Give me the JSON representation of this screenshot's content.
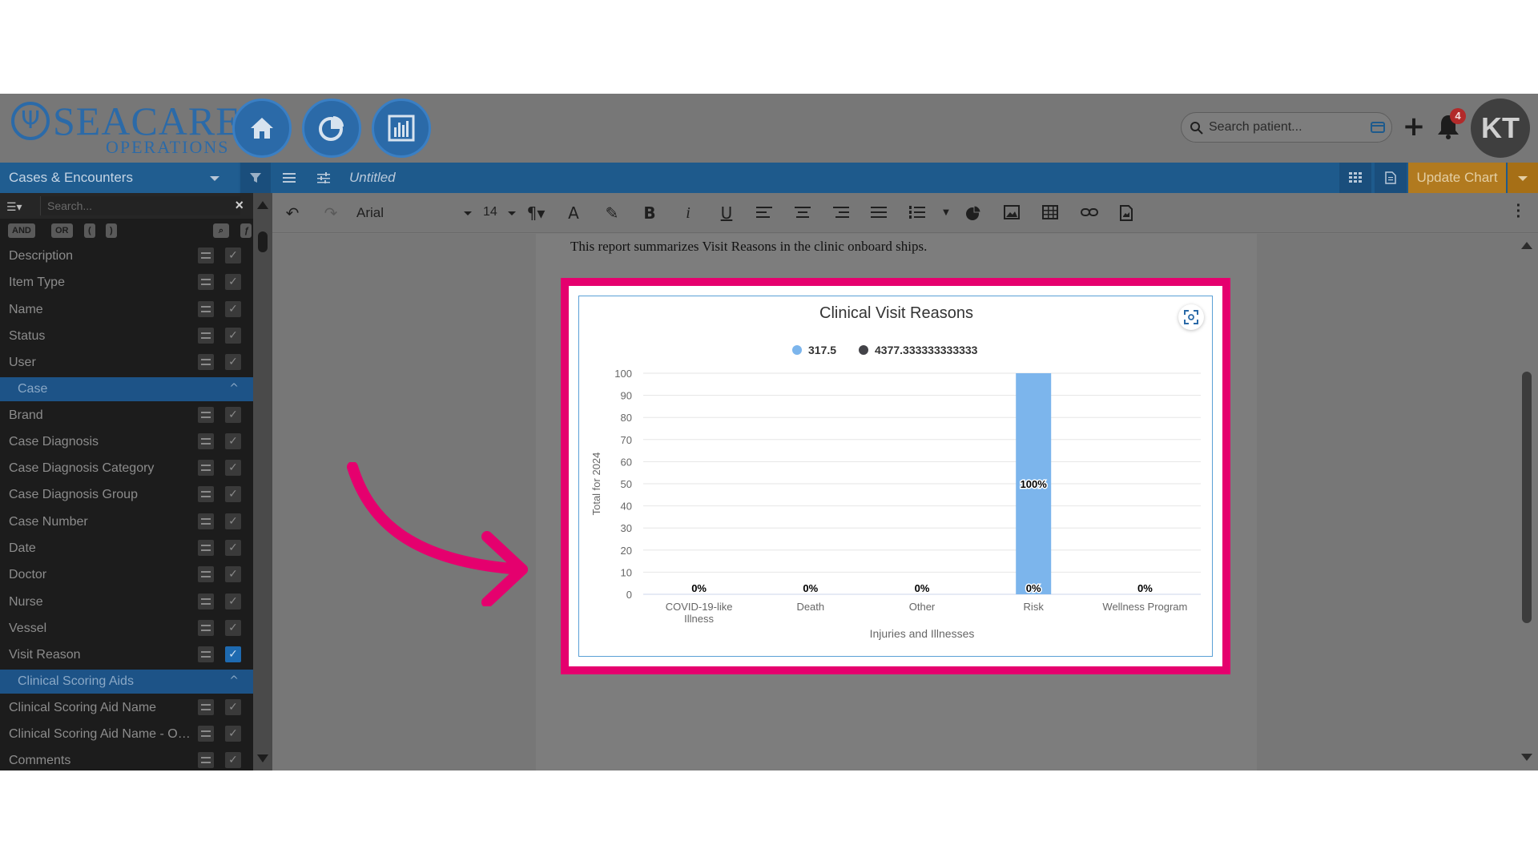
{
  "app": {
    "logo_title": "SEACARE",
    "logo_subtitle": "OPERATIONS",
    "search_placeholder": "Search patient...",
    "notification_count": "4",
    "avatar_initials": "KT"
  },
  "toolbar": {
    "dataset": "Cases & Encounters",
    "doc_title": "Untitled",
    "update_label": "Update Chart"
  },
  "sidebar": {
    "search_placeholder": "Search...",
    "ops": [
      "AND",
      "OR",
      "(",
      ")"
    ],
    "rows": [
      {
        "type": "field",
        "label": "Description",
        "checked": false
      },
      {
        "type": "field",
        "label": "Item Type",
        "checked": false
      },
      {
        "type": "field",
        "label": "Name",
        "checked": false
      },
      {
        "type": "field",
        "label": "Status",
        "checked": false
      },
      {
        "type": "field",
        "label": "User",
        "checked": false
      },
      {
        "type": "group",
        "label": "Case"
      },
      {
        "type": "field",
        "label": "Brand",
        "checked": false
      },
      {
        "type": "field",
        "label": "Case Diagnosis",
        "checked": false
      },
      {
        "type": "field",
        "label": "Case Diagnosis Category",
        "checked": false
      },
      {
        "type": "field",
        "label": "Case Diagnosis Group",
        "checked": false
      },
      {
        "type": "field",
        "label": "Case Number",
        "checked": false
      },
      {
        "type": "field",
        "label": "Date",
        "checked": false
      },
      {
        "type": "field",
        "label": "Doctor",
        "checked": false
      },
      {
        "type": "field",
        "label": "Nurse",
        "checked": false
      },
      {
        "type": "field",
        "label": "Vessel",
        "checked": false
      },
      {
        "type": "field",
        "label": "Visit Reason",
        "checked": true
      },
      {
        "type": "group",
        "label": "Clinical Scoring Aids"
      },
      {
        "type": "field",
        "label": "Clinical Scoring Aid Name",
        "checked": false
      },
      {
        "type": "field",
        "label": "Clinical Scoring Aid Name - Ot...",
        "checked": false
      },
      {
        "type": "field",
        "label": "Comments",
        "checked": false
      }
    ]
  },
  "editor": {
    "font": "Arial",
    "font_size": "14",
    "intro_text": "This report summarizes Visit Reasons in the clinic onboard ships."
  },
  "chart_data": {
    "type": "bar",
    "title": "Clinical Visit Reasons",
    "xlabel": "Injuries and Illnesses",
    "ylabel": "Total for 2024",
    "ylim": [
      0,
      100
    ],
    "yticks": [
      0,
      10,
      20,
      30,
      40,
      50,
      60,
      70,
      80,
      90,
      100
    ],
    "categories": [
      "COVID-19-like Illness",
      "Death",
      "Other",
      "Risk",
      "Wellness Program"
    ],
    "category_lines": [
      [
        "COVID-19-like",
        "Illness"
      ],
      [
        "Death"
      ],
      [
        "Other"
      ],
      [
        "Risk"
      ],
      [
        "Wellness Program"
      ]
    ],
    "legend_position": "top-center",
    "grid": true,
    "series": [
      {
        "name": "317.5",
        "color": "#7cb5ec",
        "values": [
          0,
          0,
          0,
          100,
          0
        ],
        "labels": [
          "0%",
          "0%",
          "0%",
          "100%",
          "0%"
        ]
      },
      {
        "name": "4377.333333333333",
        "color": "#434348",
        "values": [
          0,
          0,
          0,
          0,
          0
        ],
        "labels": [
          "",
          "",
          "",
          "0%",
          ""
        ]
      }
    ]
  }
}
